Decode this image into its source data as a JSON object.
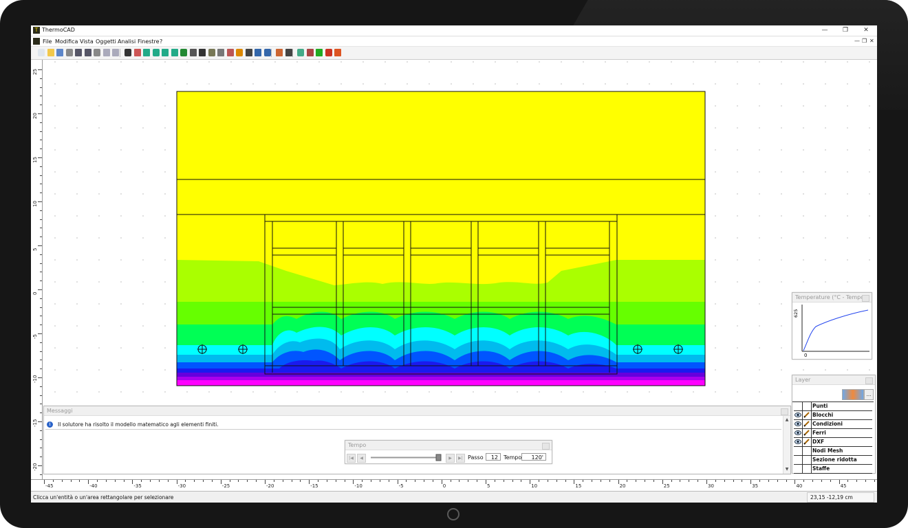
{
  "app": {
    "title": "ThermoCAD",
    "window_controls": [
      "—",
      "❐",
      "✕"
    ]
  },
  "menu": {
    "items": [
      "File",
      "Modifica",
      "Vista",
      "Oggetti",
      "Analisi",
      "Finestre",
      "?"
    ],
    "mdi_controls": [
      "—",
      "❐",
      "✕"
    ]
  },
  "toolbar": {
    "icons": [
      "new-icon",
      "open-icon",
      "save-icon",
      "print-icon",
      "undo-icon",
      "redo-icon",
      "cut-icon",
      "copy-icon",
      "paste-icon",
      "select-icon",
      "rotate-view-icon",
      "zoom-in-icon",
      "zoom-window-icon",
      "zoom-out-icon",
      "zoom-extents-icon",
      "refresh-icon",
      "measure-icon",
      "eyedropper-icon",
      "pencil-icon",
      "node-icon",
      "boundary-icon",
      "material-icon",
      "reinforcement-icon",
      "dimension-icon",
      "text-icon",
      "mesh-icon",
      "solve-icon",
      "analysis-icon",
      "results-icon",
      "check-icon",
      "fire-icon",
      "temperature-icon"
    ]
  },
  "rulers": {
    "vertical_labels": [
      "25",
      "20",
      "15",
      "10",
      "5",
      "0",
      "-5",
      "-10",
      "-15",
      "-20"
    ],
    "horizontal_labels": [
      "-45",
      "-40",
      "-35",
      "-30",
      "-25",
      "-20",
      "-15",
      "-10",
      "-5",
      "0",
      "5",
      "10",
      "15",
      "20",
      "25",
      "30",
      "35",
      "40",
      "45"
    ]
  },
  "drawing": {
    "colors": {
      "yellow": "#ffff00",
      "yellow_green": "#aaff00",
      "lime": "#66ff00",
      "green": "#00ff55",
      "cyan": "#00ffff",
      "teal": "#00bbee",
      "blue": "#0055ff",
      "navy": "#1a1aee",
      "indigo": "#6600dd",
      "violet": "#aa00ee",
      "magenta": "#ff00ff",
      "outline": "#111111"
    }
  },
  "messages": {
    "title": "Messaggi",
    "rows": [
      "Il solutore ha risolto il modello matematico agli elementi finiti."
    ]
  },
  "tempo": {
    "title": "Tempo",
    "passo_label": "Passo",
    "passo_value": "12",
    "tempo_label": "Tempo",
    "tempo_value": "120'",
    "slider_fraction": 1.0
  },
  "temperature_chart": {
    "title": "Temperature (°C - Tempo)",
    "y_label": "625",
    "x_label": "0"
  },
  "layers": {
    "title": "Layer",
    "rows": [
      {
        "name": "Punti",
        "visible": false,
        "editable": false
      },
      {
        "name": "Blocchi",
        "visible": true,
        "editable": true
      },
      {
        "name": "Condizioni",
        "visible": true,
        "editable": true
      },
      {
        "name": "Ferri",
        "visible": true,
        "editable": true
      },
      {
        "name": "DXF",
        "visible": true,
        "editable": true
      },
      {
        "name": "Nodi Mesh",
        "visible": false,
        "editable": false
      },
      {
        "name": "Sezione ridotta",
        "visible": false,
        "editable": false
      },
      {
        "name": "Staffe",
        "visible": false,
        "editable": false
      }
    ]
  },
  "status": {
    "hint": "Clicca un'entità o un'area rettangolare per selezionare",
    "coords": "23,15 -12,19 cm"
  }
}
